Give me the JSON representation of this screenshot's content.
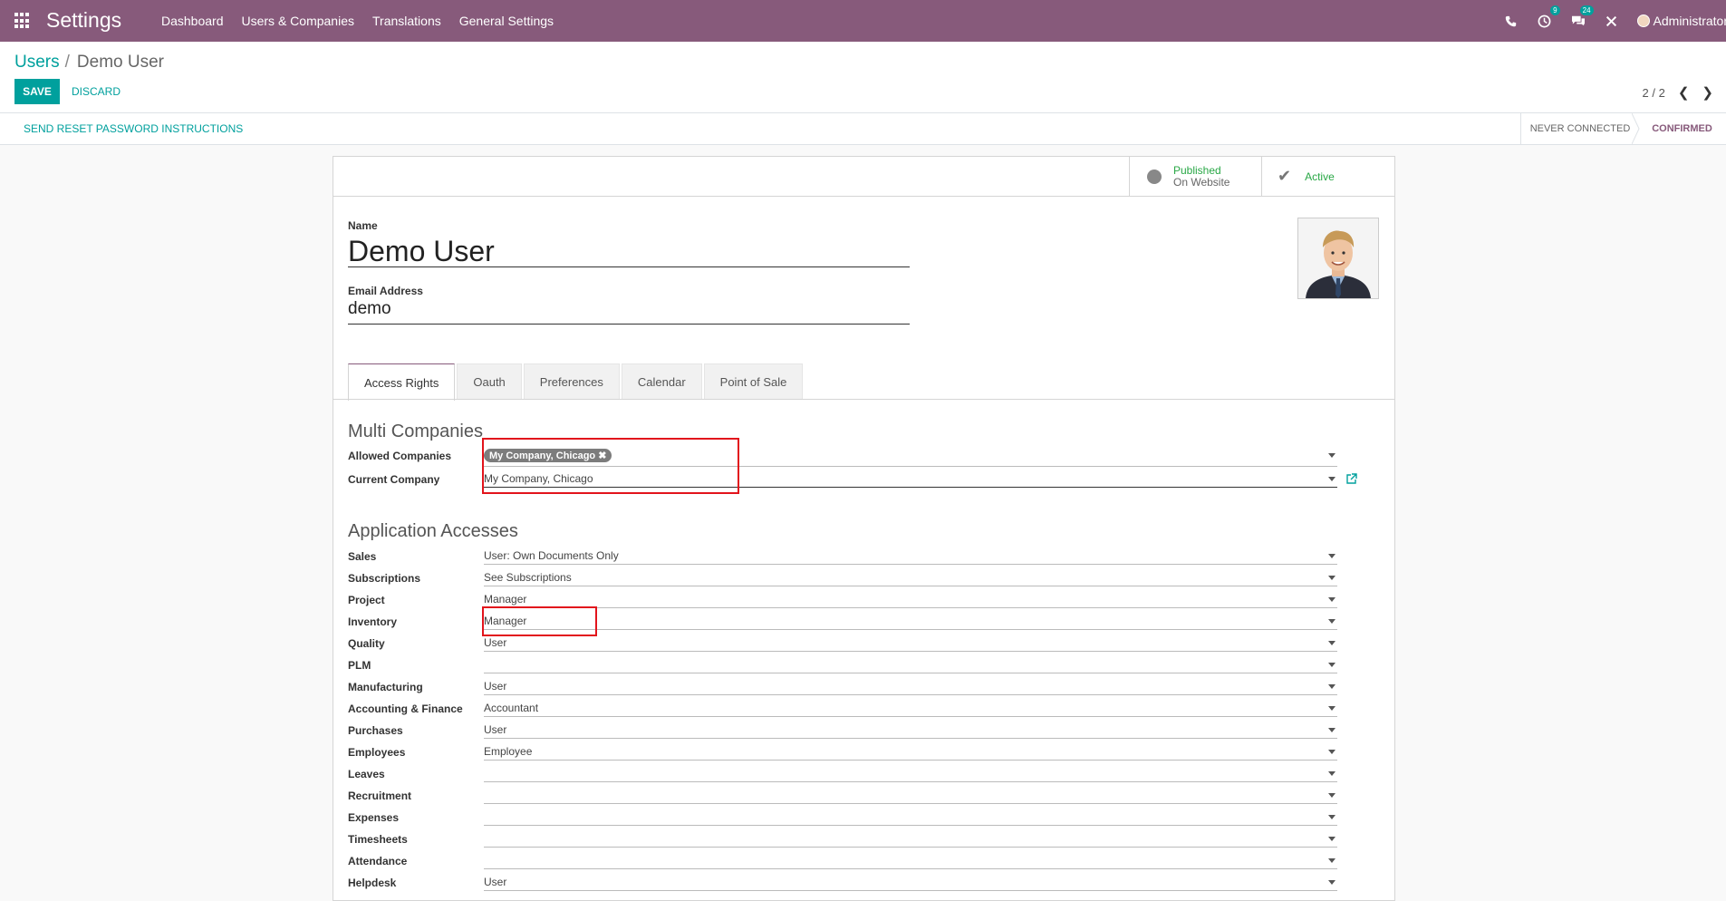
{
  "navbar": {
    "app_title": "Settings",
    "menu": [
      "Dashboard",
      "Users & Companies",
      "Translations",
      "General Settings"
    ],
    "activity_count": "9",
    "message_count": "24",
    "user": "Administrator"
  },
  "breadcrumb": {
    "parent": "Users",
    "current": "Demo User"
  },
  "actions": {
    "save": "SAVE",
    "discard": "DISCARD"
  },
  "pager": {
    "value": "2 / 2"
  },
  "header": {
    "reset_button": "SEND RESET PASSWORD INSTRUCTIONS",
    "statuses": [
      "NEVER CONNECTED",
      "CONFIRMED"
    ],
    "active_status": "CONFIRMED"
  },
  "smart_buttons": {
    "website": {
      "line1": "Published",
      "line2": "On Website"
    },
    "active": {
      "label": "Active"
    }
  },
  "form": {
    "name_label": "Name",
    "name": "Demo User",
    "email_label": "Email Address",
    "email": "demo"
  },
  "tabs": [
    "Access Rights",
    "Oauth",
    "Preferences",
    "Calendar",
    "Point of Sale"
  ],
  "active_tab": "Access Rights",
  "multi_companies": {
    "title": "Multi Companies",
    "allowed_label": "Allowed Companies",
    "allowed_tag": "My Company, Chicago",
    "current_label": "Current Company",
    "current_value": "My Company, Chicago"
  },
  "app_access": {
    "title": "Application Accesses",
    "rows": [
      {
        "label": "Sales",
        "value": "User: Own Documents Only"
      },
      {
        "label": "Subscriptions",
        "value": "See Subscriptions"
      },
      {
        "label": "Project",
        "value": "Manager"
      },
      {
        "label": "Inventory",
        "value": "Manager"
      },
      {
        "label": "Quality",
        "value": "User"
      },
      {
        "label": "PLM",
        "value": ""
      },
      {
        "label": "Manufacturing",
        "value": "User"
      },
      {
        "label": "Accounting & Finance",
        "value": "Accountant"
      },
      {
        "label": "Purchases",
        "value": "User"
      },
      {
        "label": "Employees",
        "value": "Employee"
      },
      {
        "label": "Leaves",
        "value": ""
      },
      {
        "label": "Recruitment",
        "value": ""
      },
      {
        "label": "Expenses",
        "value": ""
      },
      {
        "label": "Timesheets",
        "value": ""
      },
      {
        "label": "Attendance",
        "value": ""
      },
      {
        "label": "Helpdesk",
        "value": "User"
      }
    ]
  },
  "colors": {
    "brand": "#875a7b",
    "accent": "#00a09d",
    "highlight": "#e2141c"
  }
}
